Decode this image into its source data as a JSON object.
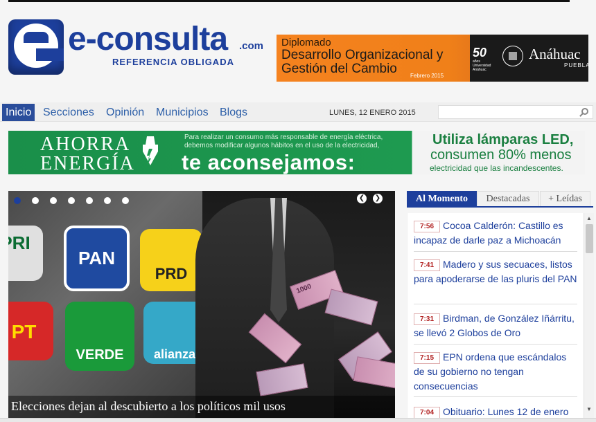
{
  "header": {
    "brand": "e-consulta",
    "dotcom": ".com",
    "tagline": "REFERENCIA OBLIGADA"
  },
  "ad_top": {
    "line1": "Diplomado",
    "line2": "Desarrollo Organizacional y",
    "line3": "Gestión del Cambio",
    "date": "Febrero 2015",
    "anniversary": "50",
    "anniversary_sub": "años Universidad Anáhuac",
    "university": "Anáhuac",
    "city": "PUEBLA"
  },
  "nav": {
    "items": [
      "Inicio",
      "Secciones",
      "Opinión",
      "Municipios",
      "Blogs"
    ],
    "date": "LUNES, 12 ENERO 2015",
    "search_placeholder": ""
  },
  "ad_mid": {
    "ahorra": "AHORRA",
    "energia": "ENERGÍA",
    "para": "Para realizar un consumo más responsable de energía eléctrica, debemos modificar algunos hábitos en el uso de la electricidad,",
    "aconsejamos": "te aconsejamos:",
    "utiliza": "Utiliza lámparas LED,",
    "consumen": "consumen 80% menos",
    "elec": "electricidad que las incandescentes."
  },
  "slider": {
    "caption": "Elecciones dejan al descubierto a los políticos mil usos",
    "dot_count": 7,
    "active_dot": 0,
    "parties": [
      "PRI",
      "PAN",
      "PRD",
      "PT",
      "VERDE",
      "alianza"
    ],
    "bill_value": "1000"
  },
  "tabs": [
    "Al Momento",
    "Destacadas",
    "+ Leídas"
  ],
  "news": [
    {
      "time": "7:56",
      "headline": "Cocoa Calderón: Castillo es incapaz de darle paz a Michoacán"
    },
    {
      "time": "7:41",
      "headline": "Madero y sus secuaces, listos para apoderarse de las pluris del PAN"
    },
    {
      "time": "7:31",
      "headline": "Birdman, de González Iñárritu, se llevó 2 Globos de Oro"
    },
    {
      "time": "7:15",
      "headline": "EPN ordena que escándalos de su gobierno no tengan consecuencias"
    },
    {
      "time": "7:04",
      "headline": "Obituario: Lunes 12 de enero"
    }
  ],
  "colors": {
    "brand_blue": "#1d3f9c",
    "nav_active": "#2a4d9b",
    "time_red": "#b22222",
    "ad_orange": "#f5821f",
    "ad_green": "#1e9a50"
  }
}
